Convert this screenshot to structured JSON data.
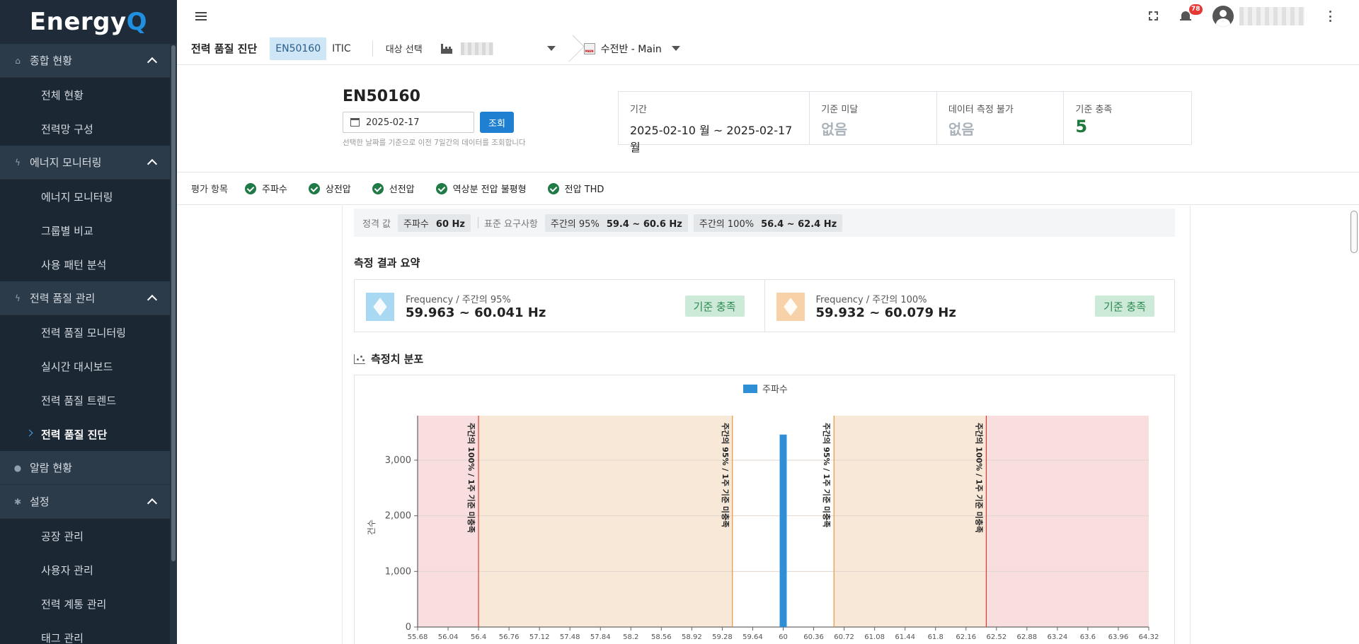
{
  "app": {
    "logo_main": "Energy",
    "logo_accent": "Q"
  },
  "sidebar": {
    "sections": [
      {
        "label": "종합 현황",
        "icon": "home-icon",
        "items": [
          "전체 현황",
          "전력망 구성"
        ]
      },
      {
        "label": "에너지 모니터링",
        "icon": "bolt-icon",
        "items": [
          "에너지 모니터링",
          "그룹별 비교",
          "사용 패턴 분석"
        ]
      },
      {
        "label": "전력 품질 관리",
        "icon": "bolt-icon",
        "items": [
          "전력 품질 모니터링",
          "실시간 대시보드",
          "전력 품질 트렌드",
          "전력 품질 진단"
        ]
      },
      {
        "label": "알람 현황",
        "icon": "bell-icon",
        "items": []
      },
      {
        "label": "설정",
        "icon": "gear-icon",
        "items": [
          "공장 관리",
          "사용자 관리",
          "전력 계통 관리",
          "태그 관리"
        ]
      }
    ],
    "active_item": "전력 품질 진단"
  },
  "topbar": {
    "notification_count": "78"
  },
  "subheader": {
    "page_title": "전력 품질 진단",
    "tabs": [
      "EN50160",
      "ITIC"
    ],
    "target_label": "대상 선택",
    "panel_name": "수전반 - Main"
  },
  "query": {
    "heading": "EN50160",
    "date": "2025-02-17",
    "button": "조회",
    "helper": "선택한 날짜를 기준으로 이전 7일간의 데이터를 조회합니다"
  },
  "summary": {
    "period_label": "기간",
    "period_value": "2025-02-10 월 ~ 2025-02-17 월",
    "below_label": "기준 미달",
    "below_value": "없음",
    "unmeasurable_label": "데이터 측정 불가",
    "unmeasurable_value": "없음",
    "meet_label": "기준 충족",
    "meet_value": "5"
  },
  "eval": {
    "label": "평가 항목",
    "items": [
      "주파수",
      "상전압",
      "선전압",
      "역상분 전압 불평형",
      "전압 THD"
    ]
  },
  "rated": {
    "label": "정격 값",
    "rated_name": "주파수",
    "rated_value": "60 Hz",
    "req_label": "표준 요구사항",
    "req1_name": "주간의 95%",
    "req1_value": "59.4 ~ 60.6 Hz",
    "req2_name": "주간의 100%",
    "req2_value": "56.4 ~ 62.4 Hz"
  },
  "results": {
    "title": "측정 결과 요약",
    "cards": [
      {
        "label": "Frequency / 주간의 95%",
        "value": "59.963 ~ 60.041 Hz",
        "badge": "기준 충족",
        "color": "#a9d8f2"
      },
      {
        "label": "Frequency / 주간의 100%",
        "value": "59.932 ~ 60.079 Hz",
        "badge": "기준 충족",
        "color": "#f7d2a8"
      }
    ]
  },
  "distribution": {
    "title": "측정치 분포"
  },
  "chart_data": {
    "type": "bar",
    "legend": [
      "주파수"
    ],
    "ylabel": "건수",
    "ylim": [
      0,
      3800
    ],
    "xlim": [
      55.68,
      64.32
    ],
    "yticks": [
      "0",
      "1,000",
      "2,000",
      "3,000"
    ],
    "ytick_values": [
      0,
      1000,
      2000,
      3000
    ],
    "xticks": [
      "55.68",
      "56.04",
      "56.4",
      "56.76",
      "57.12",
      "57.48",
      "57.84",
      "58.2",
      "58.56",
      "58.92",
      "59.28",
      "59.64",
      "60",
      "60.36",
      "60.72",
      "61.08",
      "61.44",
      "61.8",
      "62.16",
      "62.52",
      "62.88",
      "63.24",
      "63.6",
      "63.96",
      "64.32"
    ],
    "bars": [
      {
        "x": 60.0,
        "value": 3460
      }
    ],
    "bands": [
      {
        "from": 55.68,
        "to": 56.4,
        "color": "#f8dede"
      },
      {
        "from": 56.4,
        "to": 59.4,
        "color": "#f8e8d8"
      },
      {
        "from": 60.6,
        "to": 62.4,
        "color": "#f8e8d8"
      },
      {
        "from": 62.4,
        "to": 64.32,
        "color": "#f8dede"
      }
    ],
    "lines": [
      {
        "x": 56.4,
        "label": "주간의 100% / 1주 기준 미충족",
        "color": "#e03b3b"
      },
      {
        "x": 59.4,
        "label": "주간의 95% / 1주 기준 미충족",
        "color": "#e8953d"
      },
      {
        "x": 60.6,
        "label": "주간의 95% / 1주 기준 미충족",
        "color": "#e8953d"
      },
      {
        "x": 62.4,
        "label": "주간의 100% / 1주 기준 미충족",
        "color": "#e03b3b"
      }
    ],
    "bar_color": "#2f8fd6"
  }
}
